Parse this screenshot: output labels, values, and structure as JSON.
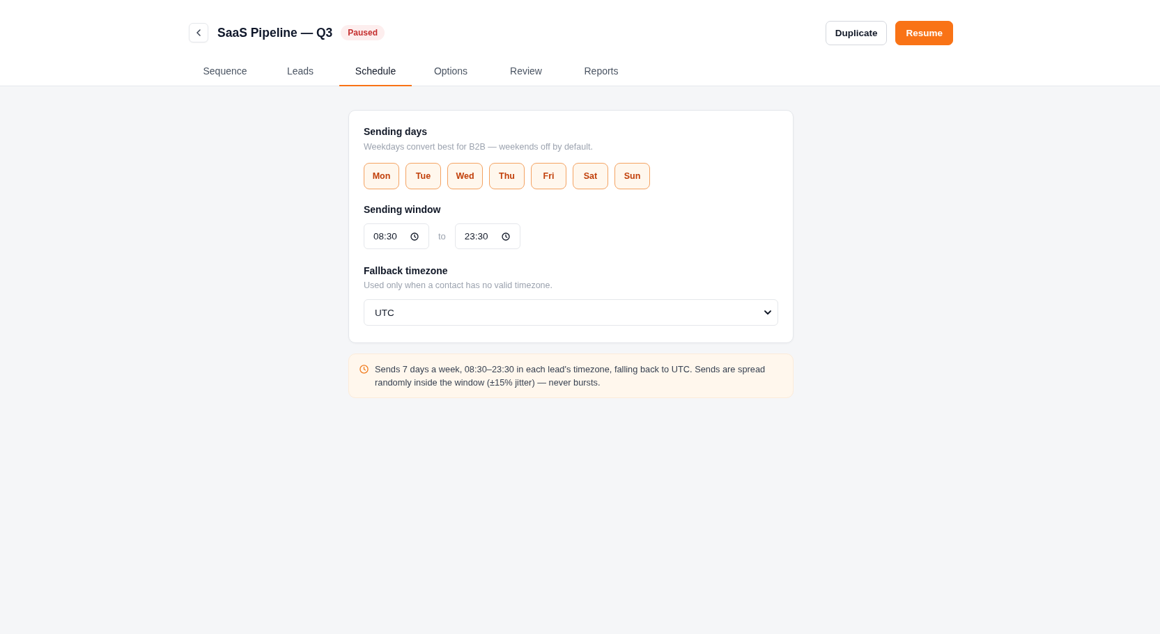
{
  "header": {
    "title": "SaaS Pipeline — Q3",
    "status": {
      "label": "Paused",
      "kind": "paused"
    },
    "actions": [
      {
        "label": "Duplicate",
        "kind": "secondary"
      },
      {
        "label": "Resume",
        "kind": "primary"
      }
    ]
  },
  "tabs": [
    {
      "label": "Sequence",
      "selected": false
    },
    {
      "label": "Leads",
      "selected": false
    },
    {
      "label": "Schedule",
      "selected": true
    },
    {
      "label": "Options",
      "selected": false
    },
    {
      "label": "Review",
      "selected": false
    },
    {
      "label": "Reports",
      "selected": false
    }
  ],
  "sending_days": {
    "title": "Sending days",
    "hint": "Weekdays convert best for B2B — weekends off by default.",
    "days": [
      {
        "label": "Mon",
        "selected": true
      },
      {
        "label": "Tue",
        "selected": true
      },
      {
        "label": "Wed",
        "selected": true
      },
      {
        "label": "Thu",
        "selected": true
      },
      {
        "label": "Fri",
        "selected": true
      },
      {
        "label": "Sat",
        "selected": true
      },
      {
        "label": "Sun",
        "selected": true
      }
    ]
  },
  "sending_window": {
    "title": "Sending window",
    "start": "08:30",
    "separator": "to",
    "end": "23:30"
  },
  "fallback_timezone": {
    "title": "Fallback timezone",
    "hint": "Used only when a contact has no valid timezone.",
    "value": "UTC"
  },
  "summary": {
    "text": "Sends 7 days a week, 08:30–23:30 in each lead's timezone, falling back to UTC. Sends are spread randomly inside the window (±15% jitter) — never bursts."
  }
}
